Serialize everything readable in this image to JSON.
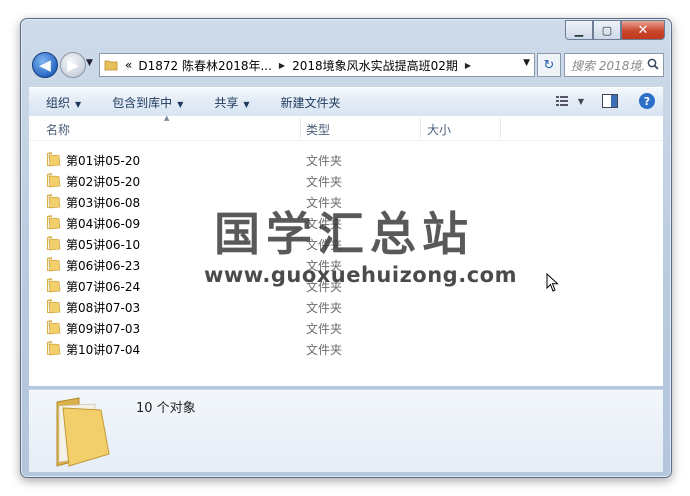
{
  "window": {
    "minimize_glyph": "▁",
    "maximize_glyph": "▢",
    "close_glyph": "✕"
  },
  "nav": {
    "back_glyph": "◀",
    "forward_glyph": "▶",
    "recent_glyph": "▼",
    "crumb_overflow": "«",
    "crumbs": [
      "D1872 陈春林2018年...",
      "2018境象风水实战提高班02期"
    ],
    "crumb_sep": "▶",
    "refresh_glyph": "↻",
    "search_placeholder": "搜索 2018境...",
    "search_icon": "search-icon"
  },
  "toolbar": {
    "organize": "组织",
    "include_library": "包含到库中",
    "share": "共享",
    "new_folder": "新建文件夹",
    "caret": "▼",
    "views_icon": "views-icon",
    "preview_icon": "preview-pane-icon",
    "help_glyph": "?"
  },
  "columns": {
    "name": "名称",
    "type": "类型",
    "size": "大小",
    "sort_glyph": "▲"
  },
  "files": [
    {
      "name": "第01讲05-20",
      "type": "文件夹"
    },
    {
      "name": "第02讲05-20",
      "type": "文件夹"
    },
    {
      "name": "第03讲06-08",
      "type": "文件夹"
    },
    {
      "name": "第04讲06-09",
      "type": "文件夹"
    },
    {
      "name": "第05讲06-10",
      "type": "文件夹"
    },
    {
      "name": "第06讲06-23",
      "type": "文件夹"
    },
    {
      "name": "第07讲06-24",
      "type": "文件夹"
    },
    {
      "name": "第08讲07-03",
      "type": "文件夹"
    },
    {
      "name": "第09讲07-03",
      "type": "文件夹"
    },
    {
      "name": "第10讲07-04",
      "type": "文件夹"
    }
  ],
  "details": {
    "count_text": "10 个对象"
  },
  "watermark": {
    "chinese": "国学汇总站",
    "url": "www.guoxuehuizong.com"
  },
  "colors": {
    "folder_yellow": "#f2cf6b",
    "accent_blue": "#2a68c6"
  }
}
